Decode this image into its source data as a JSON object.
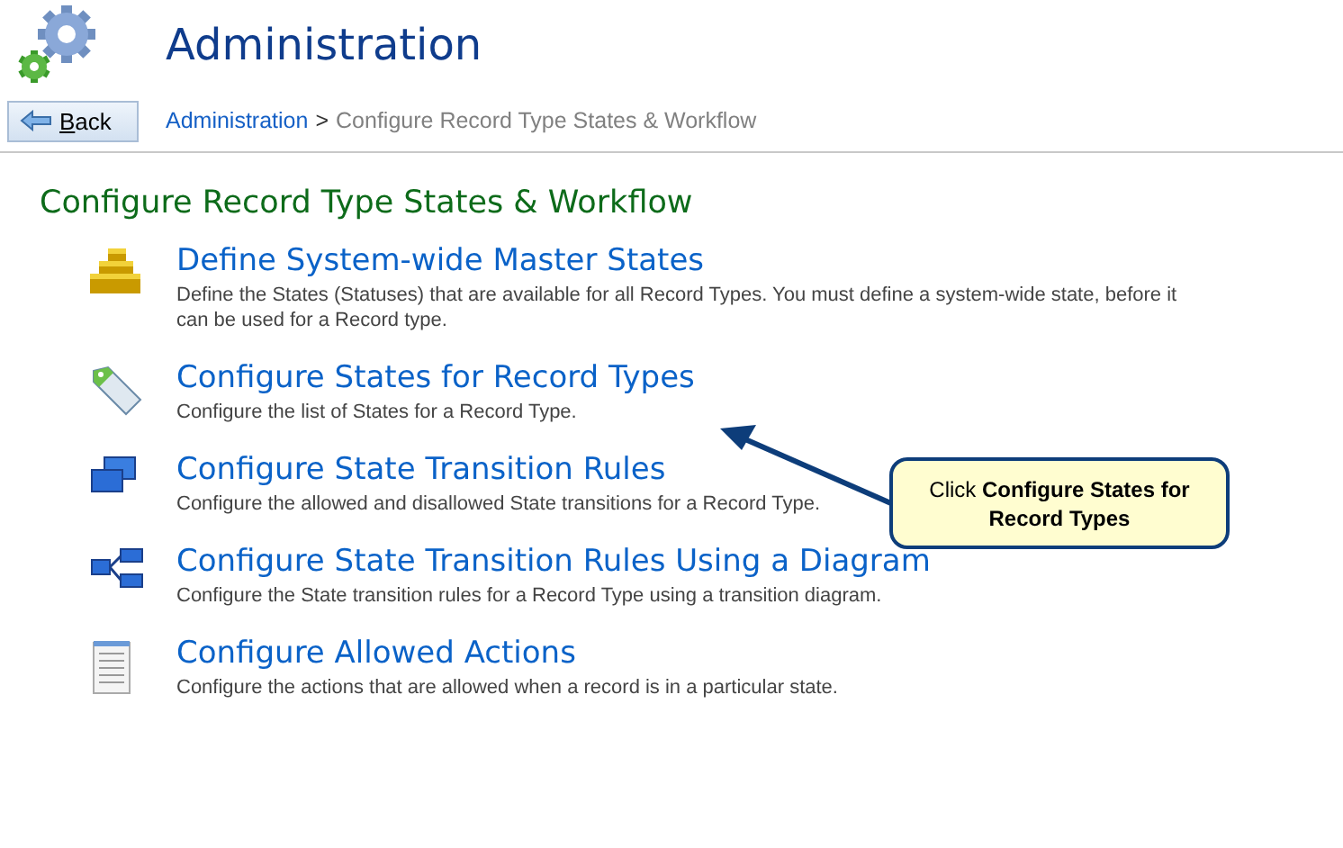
{
  "header": {
    "title": "Administration"
  },
  "back_button": {
    "label": "Back"
  },
  "breadcrumb": [
    {
      "label": "Administration",
      "kind": "link"
    },
    {
      "label": ">",
      "kind": "separator"
    },
    {
      "label": "Configure Record Type States & Workflow",
      "kind": "current"
    }
  ],
  "section_title": "Configure Record Type States & Workflow",
  "items": [
    {
      "kind": "cubes",
      "title": "Define System-wide Master States",
      "description": "Define the States (Statuses) that are available for all Record Types. You must define a system-wide state, before it can be used for a Record type."
    },
    {
      "kind": "tag",
      "title": "Configure States for Record Types",
      "description": "Configure the list of States for a Record Type."
    },
    {
      "kind": "windows",
      "title": "Configure State Transition Rules",
      "description": "Configure the allowed and disallowed State transitions for a Record Type."
    },
    {
      "kind": "diagram",
      "title": "Configure State Transition Rules Using a Diagram",
      "description": "Configure the State transition rules for a Record Type using a transition diagram."
    },
    {
      "kind": "document",
      "title": "Configure Allowed Actions",
      "description": "Configure the actions that are allowed when a record is in a particular state."
    }
  ],
  "callout": {
    "text": "Click **Configure States for Record Types**"
  }
}
